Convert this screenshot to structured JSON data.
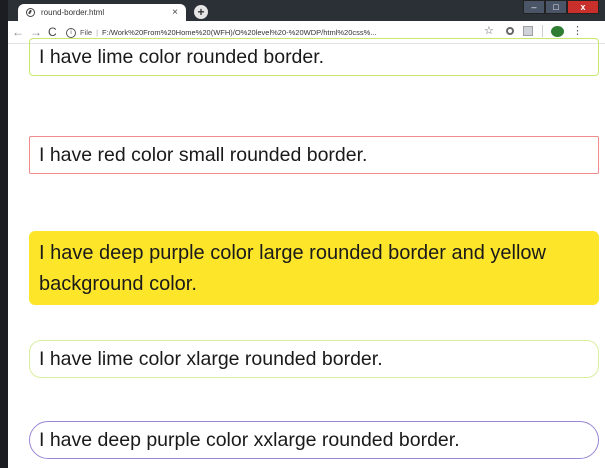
{
  "browser": {
    "tab_title": "round-border.html",
    "tab_close": "×",
    "new_tab": "+",
    "window_controls": {
      "minimize": "–",
      "maximize": "□",
      "close": "x"
    },
    "nav": {
      "back": "←",
      "forward": "→",
      "reload": "C"
    },
    "address": {
      "info": "i",
      "scheme_label": "File",
      "separator": "|",
      "url": "F:/Work%20From%20Home%20(WFH)/O%20level%20-%20WDP/html%20css%..."
    },
    "icons": {
      "star": "☆",
      "menu": "⋮"
    }
  },
  "page": {
    "boxes": [
      {
        "text": "I have lime color rounded border.",
        "border_color": "#c6e870"
      },
      {
        "text": "I have red color small rounded border.",
        "border_color": "#f28b8b"
      },
      {
        "text": "I have deep purple color large rounded border and yellow background color.",
        "background_color": "#fde52a"
      },
      {
        "text": "I have lime color xlarge rounded border.",
        "border_color": "#d9ee9e"
      },
      {
        "text": "I have deep purple color xxlarge rounded border.",
        "border_color": "#9a87d6"
      }
    ]
  }
}
